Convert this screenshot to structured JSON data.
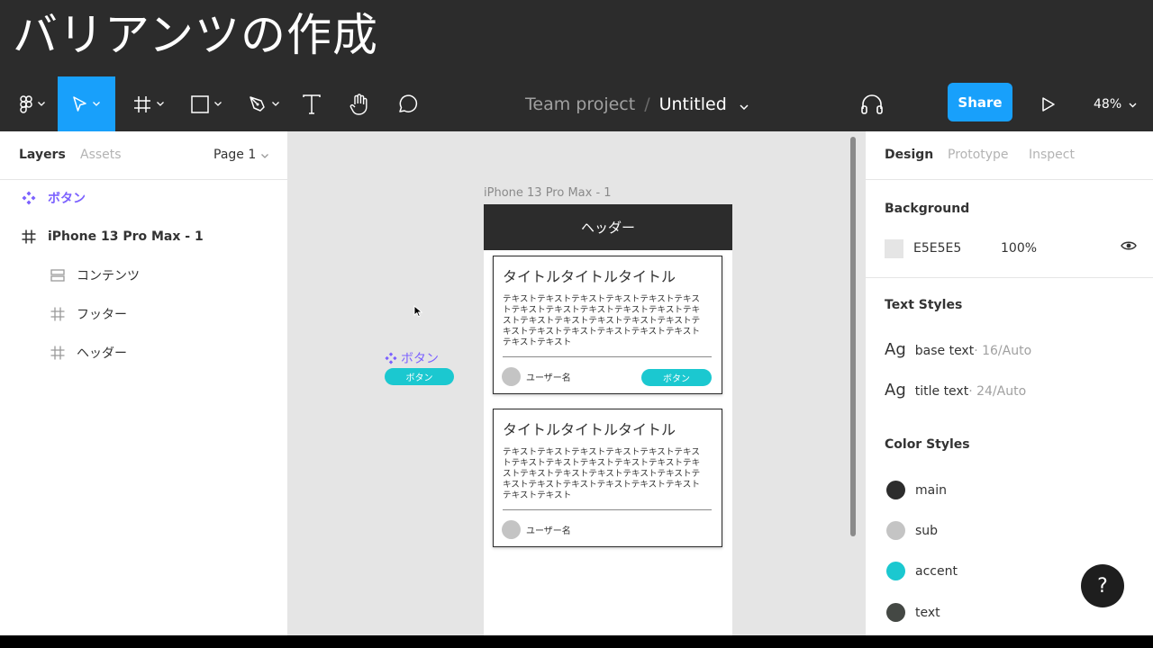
{
  "overlay_title": "バリアンツの作成",
  "toolbar": {
    "team": "Team project",
    "separator": "/",
    "filename": "Untitled",
    "share_label": "Share",
    "zoom": "48%",
    "icons": [
      "figma-menu-icon",
      "move-tool-icon",
      "frame-tool-icon",
      "shape-tool-icon",
      "pen-tool-icon",
      "text-tool-icon",
      "hand-tool-icon",
      "comment-tool-icon",
      "audio-headphones-icon",
      "present-play-icon"
    ]
  },
  "left_panel": {
    "tab_layers": "Layers",
    "tab_assets": "Assets",
    "page_selector": "Page 1",
    "layers": [
      {
        "label": "ボタン",
        "icon": "component-icon"
      },
      {
        "label": "iPhone 13 Pro Max - 1",
        "icon": "frame-icon"
      },
      {
        "label": "コンテンツ",
        "icon": "auto-layout-icon"
      },
      {
        "label": "フッター",
        "icon": "frame-icon"
      },
      {
        "label": "ヘッダー",
        "icon": "frame-icon"
      }
    ]
  },
  "canvas": {
    "frame_label": "iPhone 13 Pro Max - 1",
    "frame_header": "ヘッダー",
    "component_label": "ボタン",
    "component_button": "ボタン",
    "cards": [
      {
        "title": "タイトルタイトルタイトル",
        "body": "テキストテキストテキストテキストテキストテキストテキストテキストテキストテキストテキストテキストテキストテキストテキストテキストテキストテキストテキストテキストテキストテキストテキストテキストテキスト",
        "user": "ユーザー名",
        "button": "ボタン"
      },
      {
        "title": "タイトルタイトルタイトル",
        "body": "テキストテキストテキストテキストテキストテキストテキストテキストテキストテキストテキストテキストテキストテキストテキストテキストテキストテキストテキストテキストテキストテキストテキストテキストテキスト",
        "user": "ユーザー名"
      }
    ]
  },
  "right_panel": {
    "tab_design": "Design",
    "tab_prototype": "Prototype",
    "tab_inspect": "Inspect",
    "background": {
      "title": "Background",
      "hex": "E5E5E5",
      "opacity": "100%",
      "color": "#e5e5e5"
    },
    "text_styles": {
      "title": "Text Styles",
      "items": [
        {
          "ag": "Ag",
          "name": "base text",
          "meta": " · 16/Auto"
        },
        {
          "ag": "Ag",
          "name": "title text",
          "meta": " · 24/Auto"
        }
      ]
    },
    "color_styles": {
      "title": "Color Styles",
      "items": [
        {
          "name": "main",
          "color": "#2c2c2c"
        },
        {
          "name": "sub",
          "color": "#c4c4c4"
        },
        {
          "name": "accent",
          "color": "#1bc8d0"
        },
        {
          "name": "text",
          "color": "#444844"
        }
      ]
    },
    "help": "?"
  },
  "colors": {
    "accent_blue": "#18a0fb",
    "component_purple": "#7b61ff",
    "toolbar_bg": "#2c2c2c"
  }
}
